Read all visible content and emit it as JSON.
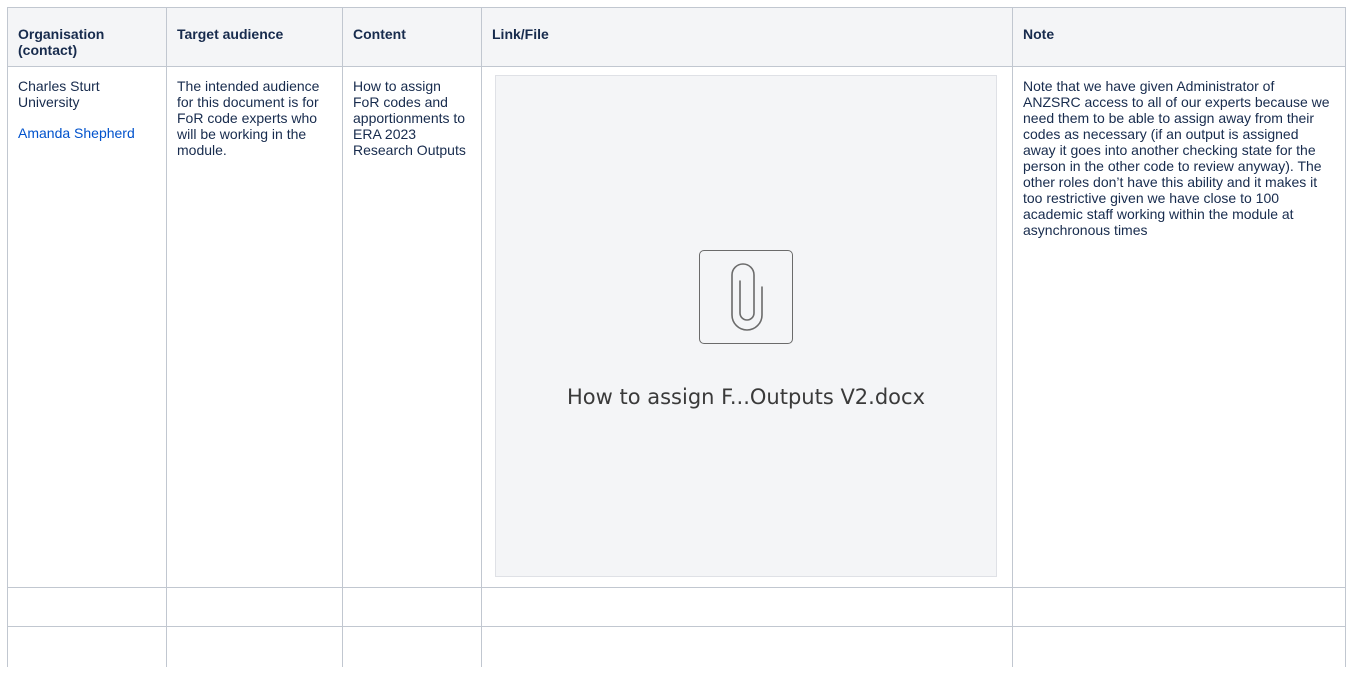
{
  "table": {
    "headers": [
      "Organisation (contact)",
      "Target audience",
      "Content",
      "Link/File",
      "Note"
    ],
    "rows": [
      {
        "organisation": "Charles Sturt University",
        "contact": "Amanda Shepherd",
        "audience": "The intended audience for this document is for FoR code experts who will be working in the module.",
        "content": "How to assign FoR codes and apportionments to ERA 2023 Research Outputs",
        "attachment": {
          "icon": "paperclip-icon",
          "file_name": "How to assign F...Outputs V2.docx"
        },
        "note": "Note that we have given Administrator of ANZSRC access to all of our experts because we need them to be able to assign away from their codes as necessary (if an output is assigned away it goes into another checking state for the person in the other code to review anyway). The other roles don’t have this ability and it makes it too restrictive given we have close to 100 academic staff working within the module at asynchronous times"
      }
    ]
  },
  "colors": {
    "header_bg": "#f4f5f7",
    "border": "#c1c7d0",
    "link": "#0052cc",
    "text": "#172b4d"
  }
}
